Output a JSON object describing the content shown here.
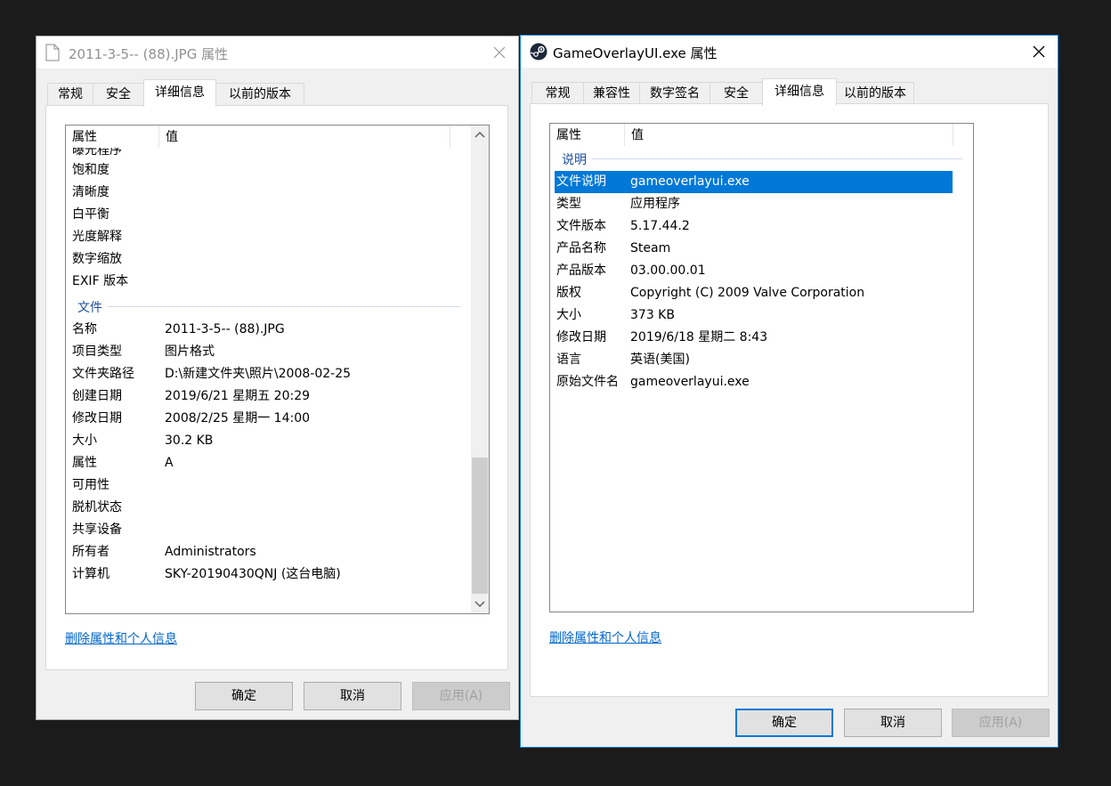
{
  "colors": {
    "accent": "#0078d7",
    "link": "#0066cc",
    "group": "#1e4e9c"
  },
  "window1": {
    "title": "2011-3-5-- (88).JPG 属性",
    "icon": "file-icon",
    "tabs": [
      {
        "label": "常规"
      },
      {
        "label": "安全"
      },
      {
        "label": "详细信息"
      },
      {
        "label": "以前的版本"
      }
    ],
    "active_tab": "详细信息",
    "header": {
      "col1": "属性",
      "col2": "值"
    },
    "cut_row": "曝光程序",
    "rows_top": [
      {
        "k": "饱和度",
        "v": ""
      },
      {
        "k": "清晰度",
        "v": ""
      },
      {
        "k": "白平衡",
        "v": ""
      },
      {
        "k": "光度解释",
        "v": ""
      },
      {
        "k": "数字缩放",
        "v": ""
      },
      {
        "k": "EXIF 版本",
        "v": ""
      }
    ],
    "group": "文件",
    "rows_file": [
      {
        "k": "名称",
        "v": "2011-3-5-- (88).JPG"
      },
      {
        "k": "项目类型",
        "v": "图片格式"
      },
      {
        "k": "文件夹路径",
        "v": "D:\\新建文件夹\\照片\\2008-02-25"
      },
      {
        "k": "创建日期",
        "v": "2019/6/21 星期五 20:29"
      },
      {
        "k": "修改日期",
        "v": "2008/2/25 星期一 14:00"
      },
      {
        "k": "大小",
        "v": "30.2 KB"
      },
      {
        "k": "属性",
        "v": "A"
      },
      {
        "k": "可用性",
        "v": ""
      },
      {
        "k": "脱机状态",
        "v": ""
      },
      {
        "k": "共享设备",
        "v": ""
      },
      {
        "k": "所有者",
        "v": "Administrators"
      },
      {
        "k": "计算机",
        "v": "SKY-20190430QNJ (这台电脑)"
      }
    ],
    "link": "删除属性和个人信息",
    "buttons": {
      "ok": "确定",
      "cancel": "取消",
      "apply": "应用(A)"
    }
  },
  "window2": {
    "title": "GameOverlayUI.exe 属性",
    "icon": "steam-icon",
    "tabs": [
      {
        "label": "常规"
      },
      {
        "label": "兼容性"
      },
      {
        "label": "数字签名"
      },
      {
        "label": "安全"
      },
      {
        "label": "详细信息"
      },
      {
        "label": "以前的版本"
      }
    ],
    "active_tab": "详细信息",
    "header": {
      "col1": "属性",
      "col2": "值"
    },
    "group": "说明",
    "rows": [
      {
        "k": "文件说明",
        "v": "gameoverlayui.exe",
        "selected": true
      },
      {
        "k": "类型",
        "v": "应用程序"
      },
      {
        "k": "文件版本",
        "v": "5.17.44.2"
      },
      {
        "k": "产品名称",
        "v": "Steam"
      },
      {
        "k": "产品版本",
        "v": "03.00.00.01"
      },
      {
        "k": "版权",
        "v": "Copyright (C) 2009 Valve Corporation"
      },
      {
        "k": "大小",
        "v": "373 KB"
      },
      {
        "k": "修改日期",
        "v": "2019/6/18 星期二 8:43"
      },
      {
        "k": "语言",
        "v": "英语(美国)"
      },
      {
        "k": "原始文件名",
        "v": "gameoverlayui.exe"
      }
    ],
    "link": "删除属性和个人信息",
    "buttons": {
      "ok": "确定",
      "cancel": "取消",
      "apply": "应用(A)"
    }
  }
}
